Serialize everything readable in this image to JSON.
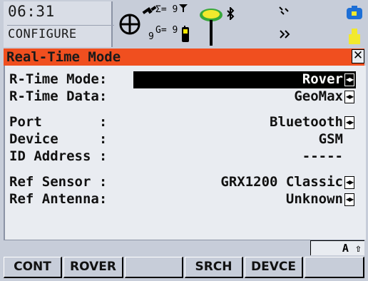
{
  "status": {
    "time": "06:31",
    "mode": "CONFIGURE",
    "sat_top": "Σ= 9",
    "sat_bottom": "G= 9",
    "gps_num": "9"
  },
  "title": {
    "text": "Real-Time Mode",
    "close": "✕"
  },
  "fields": [
    {
      "label": "R-Time Mode:",
      "value": "Rover",
      "has_arrows": true,
      "selected": true
    },
    {
      "label": "R-Time Data:",
      "value": "GeoMax",
      "has_arrows": true
    },
    {
      "label": "Port       :",
      "value": "Bluetooth",
      "has_arrows": true
    },
    {
      "label": "Device     :",
      "value": "GSM",
      "has_arrows": false
    },
    {
      "label": "ID Address :",
      "value": "-----",
      "has_arrows": false
    },
    {
      "label": "Ref Sensor :",
      "value": "GRX1200 Classic",
      "has_arrows": true
    },
    {
      "label": "Ref Antenna:",
      "value": "Unknown",
      "has_arrows": true
    }
  ],
  "arrow_glyph": "◀▶",
  "shift_indicator": "A ⇧",
  "fkeys": [
    "CONT",
    "ROVER",
    "",
    "SRCH",
    "DEVCE",
    ""
  ]
}
